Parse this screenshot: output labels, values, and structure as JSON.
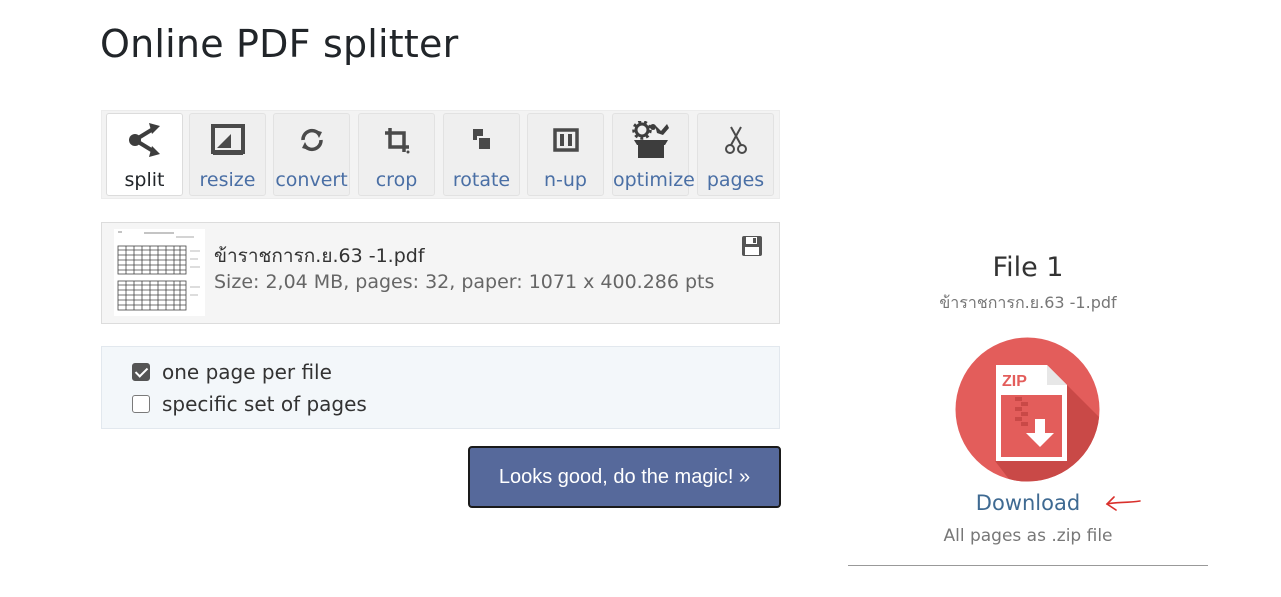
{
  "page": {
    "title": "Online PDF splitter"
  },
  "tools": [
    {
      "label": "split",
      "icon": "split-icon"
    },
    {
      "label": "resize",
      "icon": "resize-icon"
    },
    {
      "label": "convert",
      "icon": "convert-icon"
    },
    {
      "label": "crop",
      "icon": "crop-icon"
    },
    {
      "label": "rotate",
      "icon": "rotate-icon"
    },
    {
      "label": "n-up",
      "icon": "n-up-icon"
    },
    {
      "label": "optimize",
      "icon": "optimize-icon"
    },
    {
      "label": "pages",
      "icon": "scissors-icon"
    }
  ],
  "active_tool": "split",
  "file": {
    "name": "ข้าราชการก.ย.63 -1.pdf",
    "meta": "Size: 2,04 MB, pages: 32, paper: 1071 x 400.286 pts"
  },
  "options": {
    "one_page": {
      "label": "one page per file",
      "checked": true
    },
    "specific": {
      "label": "specific set of pages",
      "checked": false
    }
  },
  "magic_button": {
    "label": "Looks good, do the magic! »"
  },
  "result": {
    "title": "File 1",
    "filename": "ข้าราชการก.ย.63 -1.pdf",
    "zip_label": "ZIP",
    "download_label": "Download",
    "download_sub": "All pages as .zip file"
  },
  "colors": {
    "accent": "#56699b",
    "link": "#3f6a92",
    "zip_circle": "#e35d5b",
    "annotation_arrow": "#d9302c"
  }
}
